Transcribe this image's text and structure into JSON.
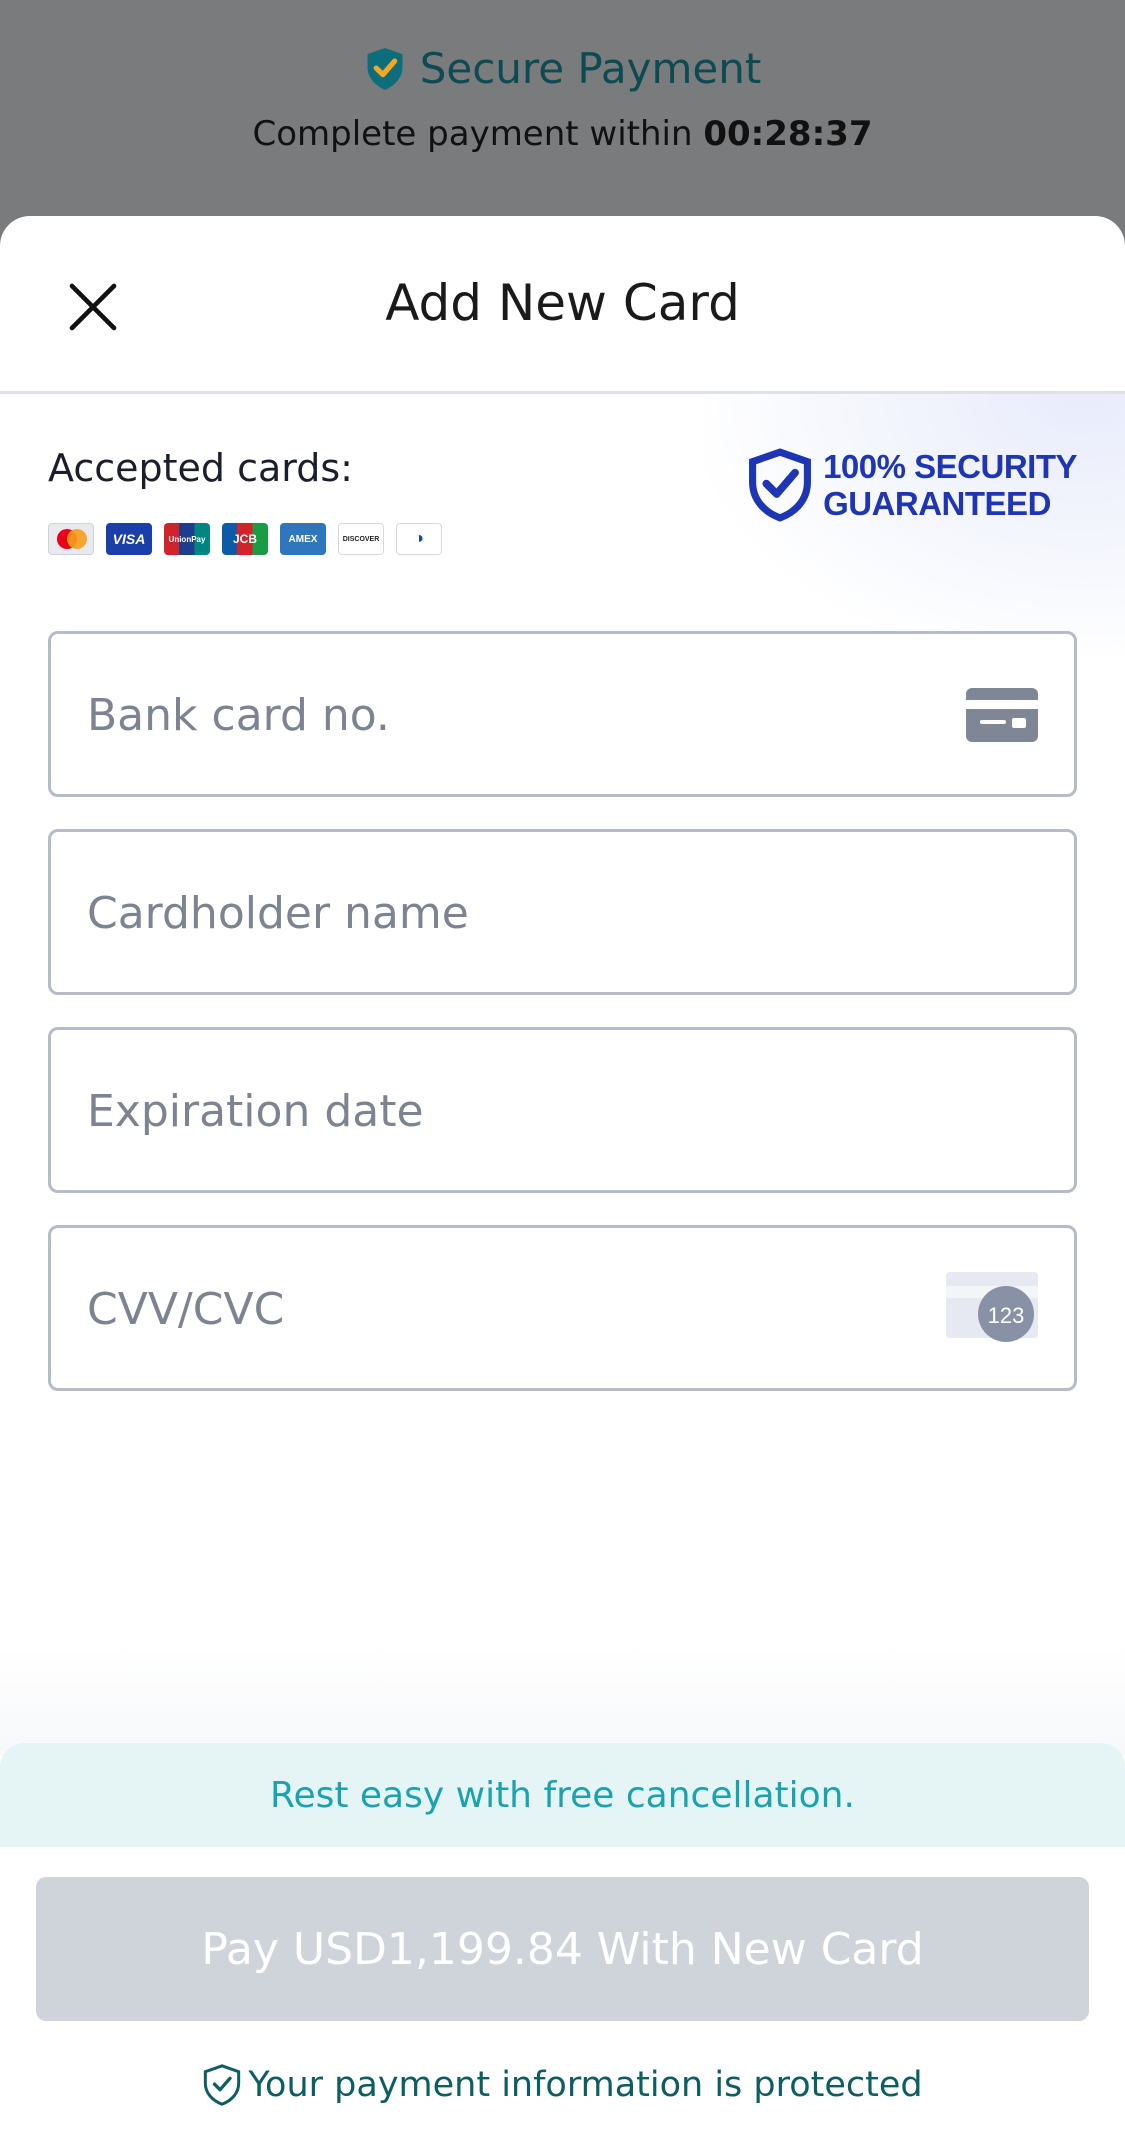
{
  "header": {
    "title": "Secure Payment",
    "countdown_prefix": "Complete payment within",
    "countdown_time": "00:28:37"
  },
  "sheet": {
    "title": "Add New Card",
    "accepted_label": "Accepted cards:",
    "accepted_cards": [
      "Mastercard",
      "VISA",
      "UnionPay",
      "JCB",
      "AMEX",
      "DISCOVER",
      "Diners Club"
    ],
    "security_badge": {
      "line1": "100% SECURITY",
      "line2": "GUARANTEED"
    }
  },
  "form": {
    "card_number": {
      "placeholder": "Bank card no.",
      "value": "",
      "icon": "credit-card-icon"
    },
    "cardholder": {
      "placeholder": "Cardholder name",
      "value": ""
    },
    "expiration": {
      "placeholder": "Expiration date",
      "value": ""
    },
    "cvv": {
      "placeholder": "CVV/CVC",
      "value": "",
      "icon": "cvv-card-icon",
      "icon_text": "123"
    }
  },
  "footer": {
    "cancel_banner": "Rest easy with free cancellation.",
    "pay_button": "Pay USD1,199.84 With New Card",
    "protected_text": "Your payment information is protected"
  },
  "colors": {
    "brand_teal": "#0d4a52",
    "banner_text": "#1aa2b0",
    "banner_bg": "#e5f5f5",
    "badge_blue": "#1f36b4",
    "pay_button_disabled": "#cfd3da"
  }
}
